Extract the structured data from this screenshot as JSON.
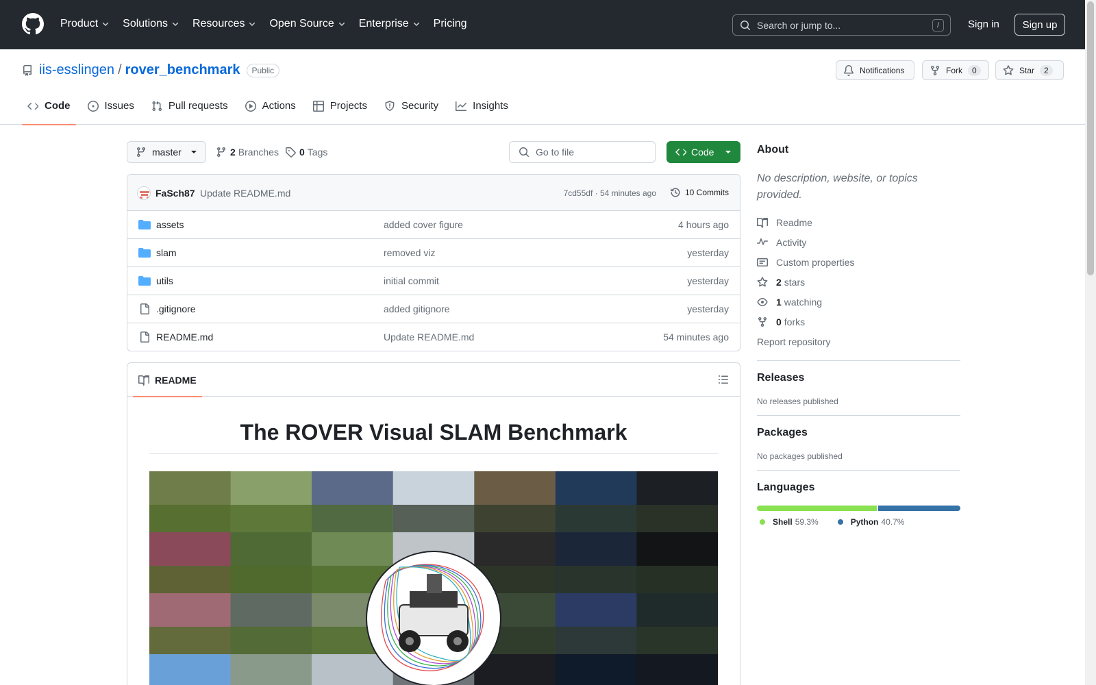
{
  "header": {
    "nav": [
      {
        "label": "Product",
        "dropdown": true
      },
      {
        "label": "Solutions",
        "dropdown": true
      },
      {
        "label": "Resources",
        "dropdown": true
      },
      {
        "label": "Open Source",
        "dropdown": true
      },
      {
        "label": "Enterprise",
        "dropdown": true
      },
      {
        "label": "Pricing",
        "dropdown": false
      }
    ],
    "search_placeholder": "Search or jump to...",
    "search_shortcut": "/",
    "sign_in": "Sign in",
    "sign_up": "Sign up"
  },
  "repo": {
    "owner": "iis-esslingen",
    "separator": "/",
    "name": "rover_benchmark",
    "visibility": "Public",
    "notifications_label": "Notifications",
    "fork_label": "Fork",
    "fork_count": "0",
    "star_label": "Star",
    "star_count": "2",
    "tabs": [
      {
        "label": "Code",
        "icon": "code-icon",
        "active": true
      },
      {
        "label": "Issues",
        "icon": "issue-icon",
        "active": false
      },
      {
        "label": "Pull requests",
        "icon": "pull-request-icon",
        "active": false
      },
      {
        "label": "Actions",
        "icon": "play-icon",
        "active": false
      },
      {
        "label": "Projects",
        "icon": "table-icon",
        "active": false
      },
      {
        "label": "Security",
        "icon": "shield-icon",
        "active": false
      },
      {
        "label": "Insights",
        "icon": "graph-icon",
        "active": false
      }
    ]
  },
  "toolbar": {
    "branch": "master",
    "branches_count": "2",
    "branches_label": "Branches",
    "tags_count": "0",
    "tags_label": "Tags",
    "goto_placeholder": "Go to file",
    "code_button": "Code"
  },
  "latest_commit": {
    "author": "FaSch87",
    "message": "Update README.md",
    "hash_time": "7cd55df · 54 minutes ago",
    "commits_label": "10 Commits"
  },
  "files": [
    {
      "type": "folder",
      "name": "assets",
      "message": "added cover figure",
      "time": "4 hours ago"
    },
    {
      "type": "folder",
      "name": "slam",
      "message": "removed viz",
      "time": "yesterday"
    },
    {
      "type": "folder",
      "name": "utils",
      "message": "initial commit",
      "time": "yesterday"
    },
    {
      "type": "file",
      "name": ".gitignore",
      "message": "added gitignore",
      "time": "yesterday"
    },
    {
      "type": "file",
      "name": "README.md",
      "message": "Update README.md",
      "time": "54 minutes ago"
    }
  ],
  "readme": {
    "tab_label": "README",
    "title": "The ROVER Visual SLAM Benchmark"
  },
  "about": {
    "heading": "About",
    "description": "No description, website, or topics provided.",
    "items": [
      {
        "icon": "book-icon",
        "count": "",
        "label": "Readme"
      },
      {
        "icon": "pulse-icon",
        "count": "",
        "label": "Activity"
      },
      {
        "icon": "note-icon",
        "count": "",
        "label": "Custom properties"
      },
      {
        "icon": "star-icon",
        "count": "2",
        "label": "stars"
      },
      {
        "icon": "eye-icon",
        "count": "1",
        "label": "watching"
      },
      {
        "icon": "fork-icon",
        "count": "0",
        "label": "forks"
      }
    ],
    "report": "Report repository"
  },
  "releases": {
    "heading": "Releases",
    "text": "No releases published"
  },
  "packages": {
    "heading": "Packages",
    "text": "No packages published"
  },
  "languages": {
    "heading": "Languages",
    "items": [
      {
        "name": "Shell",
        "percent": "59.3%",
        "value": 59.3,
        "color": "#89e051"
      },
      {
        "name": "Python",
        "percent": "40.7%",
        "value": 40.7,
        "color": "#3572A5"
      }
    ]
  }
}
